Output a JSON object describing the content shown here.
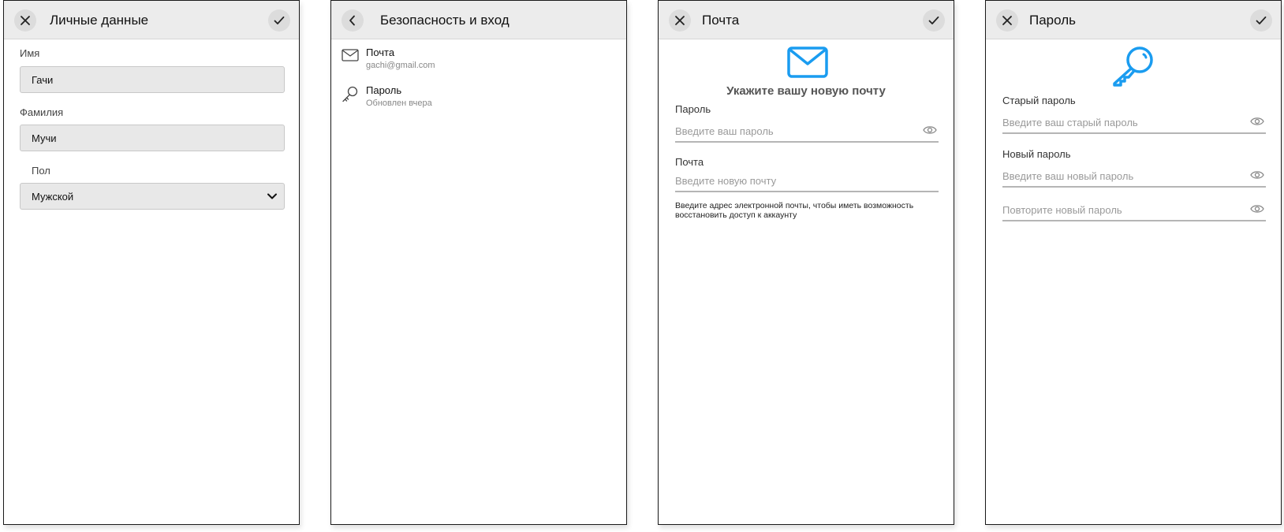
{
  "colors": {
    "accent": "#1a9cf0",
    "header_bg": "#ececec",
    "input_bg": "#e8e8e8"
  },
  "personal": {
    "title": "Личные данные",
    "left_icon": "close-icon",
    "right_icon": "check-icon",
    "first_name_label": "Имя",
    "first_name_value": "Гачи",
    "last_name_label": "Фамилия",
    "last_name_value": "Мучи",
    "gender_label": "Пол",
    "gender_value": "Мужской"
  },
  "security": {
    "title": "Безопасность и вход",
    "left_icon": "chevron-left-icon",
    "items": [
      {
        "title": "Почта",
        "subtitle": "gachi@gmail.com",
        "icon": "mail-icon"
      },
      {
        "title": "Пароль",
        "subtitle": "Обновлен вчера",
        "icon": "key-icon"
      }
    ]
  },
  "email": {
    "title": "Почта",
    "left_icon": "close-icon",
    "right_icon": "check-icon",
    "illustration": "mail-icon",
    "heading": "Укажите вашу новую почту",
    "password_label": "Пароль",
    "password_placeholder": "Введите ваш пароль",
    "email_label": "Почта",
    "email_placeholder": "Введите новую почту",
    "hint_line1": "Введите адрес электронной почты, чтобы иметь возможность",
    "hint_line2": "восстановить доступ к аккаунту"
  },
  "password": {
    "title": "Пароль",
    "left_icon": "close-icon",
    "right_icon": "check-icon",
    "illustration": "key-icon",
    "old_label": "Старый пароль",
    "old_placeholder": "Введите ваш старый пароль",
    "new_label": "Новый пароль",
    "new_placeholder": "Введите ваш новый пароль",
    "repeat_placeholder": "Повторите новый пароль"
  }
}
